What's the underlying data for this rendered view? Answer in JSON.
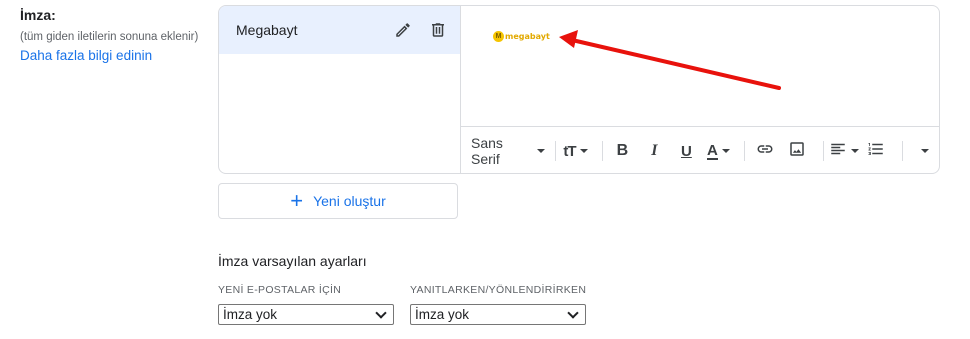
{
  "signature_section": {
    "title": "İmza:",
    "subtitle": "(tüm giden iletilerin sonuna eklenir)",
    "learn_more": "Daha fazla bilgi edinin"
  },
  "signatures": [
    {
      "name": "Megabayt",
      "selected": true
    }
  ],
  "editor": {
    "logo_text": "megabayt",
    "logo_mark": "M",
    "toolbar": {
      "font_family": "Sans Serif",
      "buttons": [
        {
          "name": "text-size-icon",
          "label": "tT"
        },
        {
          "name": "bold-icon",
          "label": "B"
        },
        {
          "name": "italic-icon",
          "label": "I"
        },
        {
          "name": "underline-icon",
          "label": "U"
        },
        {
          "name": "text-color-icon",
          "label": "A"
        },
        {
          "name": "link-icon"
        },
        {
          "name": "image-icon"
        },
        {
          "name": "align-icon"
        },
        {
          "name": "numbered-list-icon"
        },
        {
          "name": "more-options-icon"
        }
      ]
    }
  },
  "new_button": {
    "label": "Yeni oluştur",
    "icon": "plus-icon"
  },
  "defaults": {
    "title": "İmza varsayılan ayarları",
    "new_emails": {
      "label": "YENİ E-POSTALAR İÇİN",
      "value": "İmza yok"
    },
    "reply_forward": {
      "label": "YANITLARKEN/YÖNLENDİRİRKEN",
      "value": "İmza yok"
    }
  },
  "colors": {
    "accent": "#1a73e8",
    "selected_bg": "#e8f0fe",
    "annotation_arrow": "#e8120c",
    "logo": "#f5c400"
  }
}
